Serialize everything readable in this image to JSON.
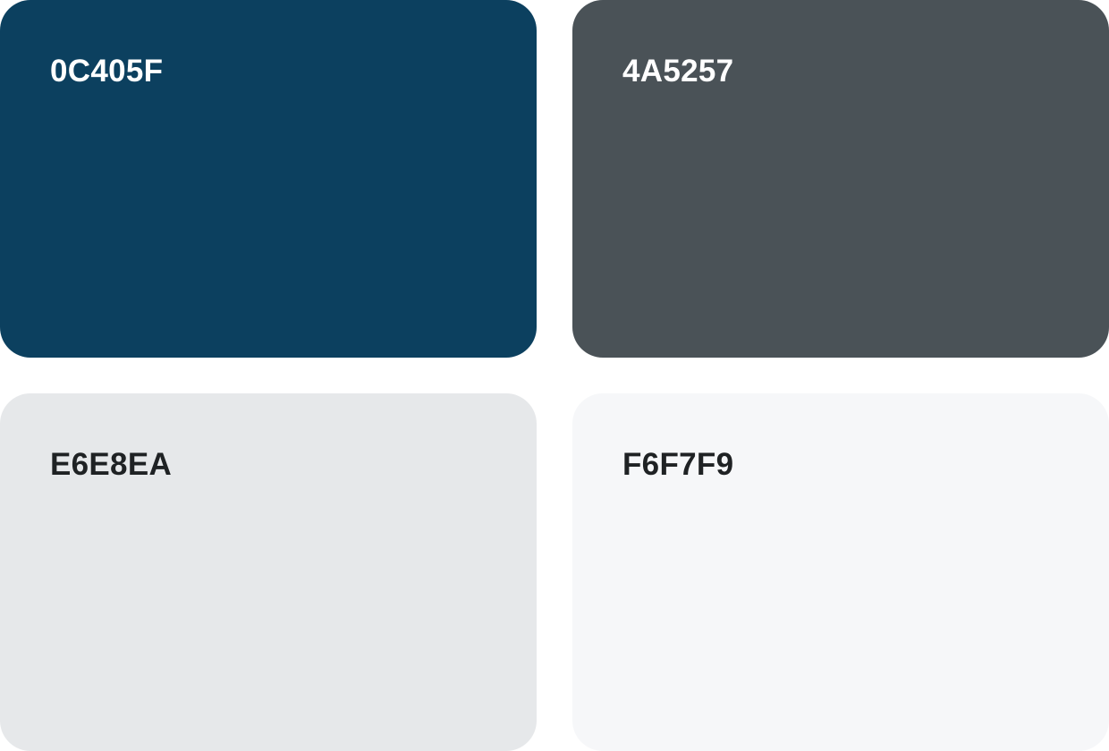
{
  "swatches": [
    {
      "label": "0C405F",
      "color": "#0C405F",
      "text_color": "#FFFFFF"
    },
    {
      "label": "4A5257",
      "color": "#4A5257",
      "text_color": "#FFFFFF"
    },
    {
      "label": "E6E8EA",
      "color": "#E6E8EA",
      "text_color": "#1F2224"
    },
    {
      "label": "F6F7F9",
      "color": "#F6F7F9",
      "text_color": "#1F2224"
    }
  ]
}
